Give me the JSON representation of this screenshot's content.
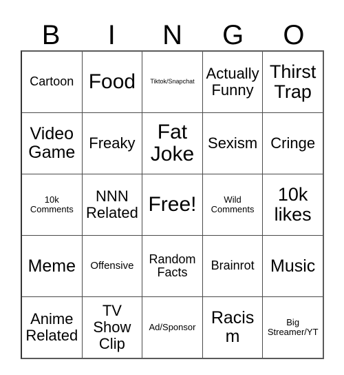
{
  "card": {
    "title_letters": [
      "B",
      "I",
      "N",
      "G",
      "O"
    ],
    "columns": 5,
    "rows": 5,
    "free_space_label": "Free!",
    "border_color": "#4a4a4a",
    "background_color": "#ffffff",
    "text_color": "#000000",
    "cells": [
      [
        {
          "label": "Cartoon",
          "size": "fs-lg"
        },
        {
          "label": "Food",
          "size": "fs-4xl"
        },
        {
          "label": "Tiktok/Snapchat",
          "size": "fs-xs"
        },
        {
          "label": "Actually\nFunny",
          "size": "fs-xl"
        },
        {
          "label": "Thirst\nTrap",
          "size": "fs-3xl"
        }
      ],
      [
        {
          "label": "Video\nGame",
          "size": "fs-2xl"
        },
        {
          "label": "Freaky",
          "size": "fs-xl"
        },
        {
          "label": "Fat\nJoke",
          "size": "fs-4xl"
        },
        {
          "label": "Sexism",
          "size": "fs-xl"
        },
        {
          "label": "Cringe",
          "size": "fs-xl"
        }
      ],
      [
        {
          "label": "10k\nComments",
          "size": "fs-sm"
        },
        {
          "label": "NNN\nRelated",
          "size": "fs-xl"
        },
        {
          "label": "Free!",
          "size": "fs-4xl"
        },
        {
          "label": "Wild\nComments",
          "size": "fs-sm"
        },
        {
          "label": "10k\nlikes",
          "size": "fs-3xl"
        }
      ],
      [
        {
          "label": "Meme",
          "size": "fs-2xl"
        },
        {
          "label": "Offensive",
          "size": "fs-md"
        },
        {
          "label": "Random\nFacts",
          "size": "fs-lg"
        },
        {
          "label": "Brainrot",
          "size": "fs-lg"
        },
        {
          "label": "Music",
          "size": "fs-2xl"
        }
      ],
      [
        {
          "label": "Anime\nRelated",
          "size": "fs-xl"
        },
        {
          "label": "TV\nShow\nClip",
          "size": "fs-xl"
        },
        {
          "label": "Ad/Sponsor",
          "size": "fs-sm"
        },
        {
          "label": "Racism",
          "size": "fs-2xl"
        },
        {
          "label": "Big\nStreamer/YT",
          "size": "fs-sm"
        }
      ]
    ]
  }
}
